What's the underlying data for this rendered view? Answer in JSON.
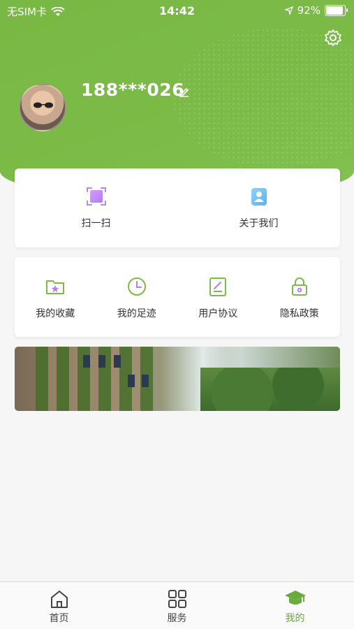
{
  "status_bar": {
    "carrier": "无SIM卡",
    "time": "14:42",
    "battery": "92%",
    "battery_level": 0.92
  },
  "profile": {
    "phone": "188***026"
  },
  "quick_actions": [
    {
      "label": "扫一扫",
      "icon": "scan-icon"
    },
    {
      "label": "关于我们",
      "icon": "contact-icon"
    }
  ],
  "menu": [
    {
      "label": "我的收藏",
      "icon": "favorite-folder-icon"
    },
    {
      "label": "我的足迹",
      "icon": "clock-icon"
    },
    {
      "label": "用户协议",
      "icon": "agreement-icon"
    },
    {
      "label": "隐私政策",
      "icon": "lock-icon"
    }
  ],
  "tabs": [
    {
      "label": "首页",
      "icon": "home-icon"
    },
    {
      "label": "服务",
      "icon": "grid-icon"
    },
    {
      "label": "我的",
      "icon": "graduation-cap-icon",
      "active": true
    }
  ],
  "colors": {
    "primary": "#7cbb47",
    "active_tab": "#6aab3d"
  }
}
